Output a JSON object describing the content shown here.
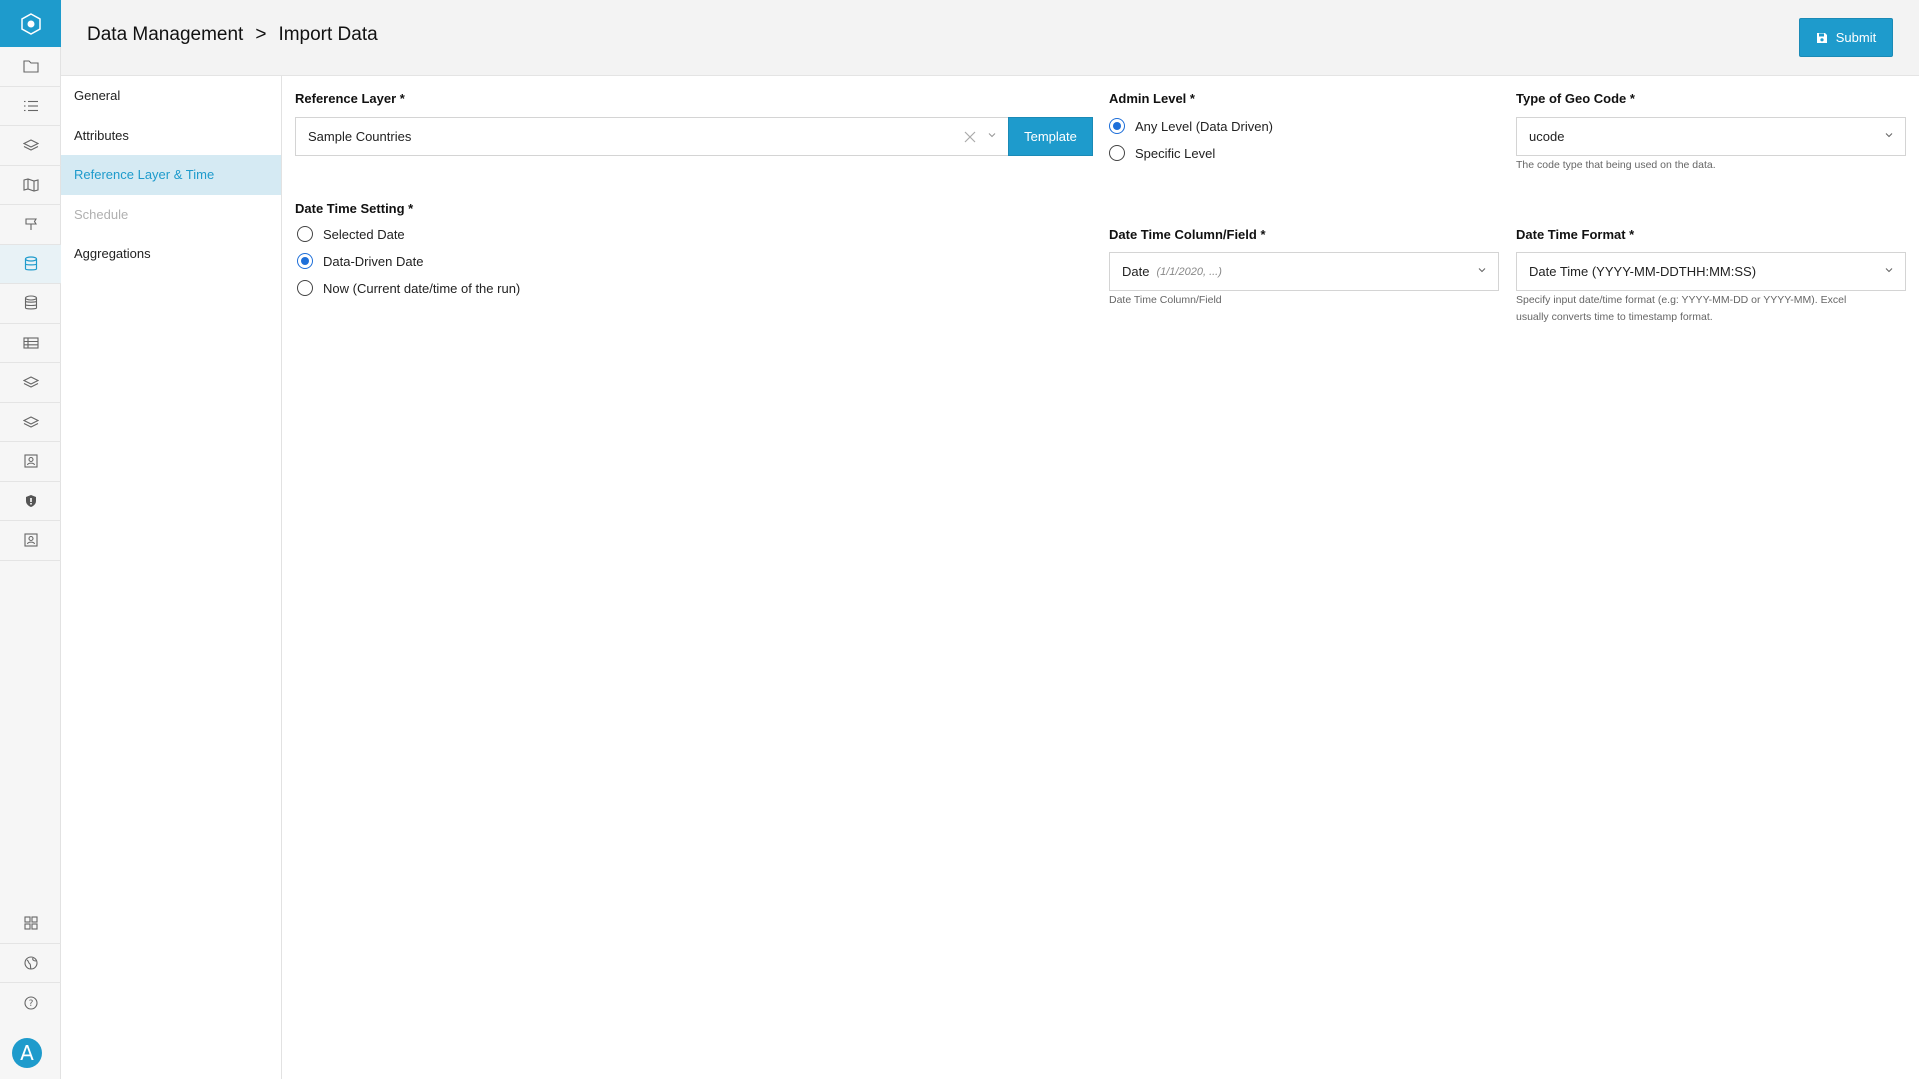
{
  "header": {
    "breadcrumb_parent": "Data Management",
    "breadcrumb_sep": ">",
    "breadcrumb_current": "Import Data",
    "submit_label": "Submit"
  },
  "rail": {
    "icons": [
      "folder-icon",
      "list-icon",
      "layers-icon",
      "map-icon",
      "signpost-icon",
      "database-icon",
      "database-stack-icon",
      "table-icon",
      "layers-icon",
      "layers-icon",
      "contact-icon",
      "shield-icon",
      "contact-icon"
    ],
    "bottom_icons": [
      "grid-icon",
      "globe-icon",
      "help-icon"
    ],
    "avatar_letter": "A"
  },
  "subnav": {
    "items": [
      {
        "label": "General",
        "state": "normal"
      },
      {
        "label": "Attributes",
        "state": "normal"
      },
      {
        "label": "Reference Layer & Time",
        "state": "active"
      },
      {
        "label": "Schedule",
        "state": "disabled"
      },
      {
        "label": "Aggregations",
        "state": "normal"
      }
    ]
  },
  "form": {
    "reference_layer": {
      "label": "Reference Layer *",
      "value": "Sample Countries",
      "template_label": "Template"
    },
    "admin_level": {
      "label": "Admin Level *",
      "options": [
        {
          "label": "Any Level (Data Driven)",
          "checked": true
        },
        {
          "label": "Specific Level",
          "checked": false
        }
      ]
    },
    "geo_code": {
      "label": "Type of Geo Code *",
      "value": "ucode",
      "help": "The code type that being used on the data."
    },
    "date_time_setting": {
      "label": "Date Time Setting *",
      "options": [
        {
          "label": "Selected Date",
          "checked": false
        },
        {
          "label": "Data-Driven Date",
          "checked": true
        },
        {
          "label": "Now (Current date/time of the run)",
          "checked": false
        }
      ]
    },
    "date_time_column": {
      "label": "Date Time Column/Field *",
      "value": "Date",
      "hint": "(1/1/2020, ...)",
      "help": "Date Time Column/Field"
    },
    "date_time_format": {
      "label": "Date Time Format *",
      "value": "Date Time (YYYY-MM-DDTHH:MM:SS)",
      "help_line1": "Specify input date/time format (e.g: YYYY-MM-DD or YYYY-MM). Excel",
      "help_line2": "usually converts time to timestamp format."
    }
  },
  "colors": {
    "accent": "#1e9bcc",
    "radio_checked": "#1e6fd9",
    "active_nav_bg": "#d5eaf3"
  }
}
